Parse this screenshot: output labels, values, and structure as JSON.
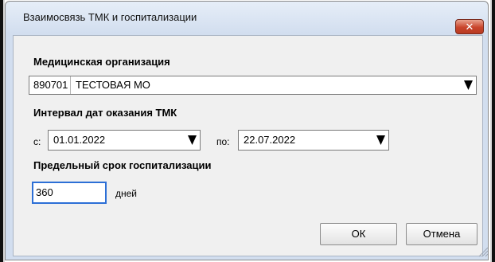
{
  "window": {
    "title": "Взаимосвязь ТМК и госпитализации",
    "close_glyph": "✕"
  },
  "org": {
    "label": "Медицинская организация",
    "code": "890701",
    "name": "ТЕСТОВАЯ МО"
  },
  "interval": {
    "label": "Интервал дат оказания ТМК",
    "from_label": "с:",
    "from_value": "01.01.2022",
    "to_label": "по:",
    "to_value": "22.07.2022"
  },
  "limit": {
    "label": "Предельный срок госпитализации",
    "value": "360",
    "unit": "дней"
  },
  "buttons": {
    "ok": "ОК",
    "cancel": "Отмена"
  },
  "icons": {
    "dropdown": "triangle-down-icon",
    "close": "close-icon",
    "grip": "resize-grip-icon"
  },
  "colors": {
    "close_button": "#c9452c",
    "focus_border": "#2c6fd6",
    "client_bg": "#f0f0f0"
  }
}
